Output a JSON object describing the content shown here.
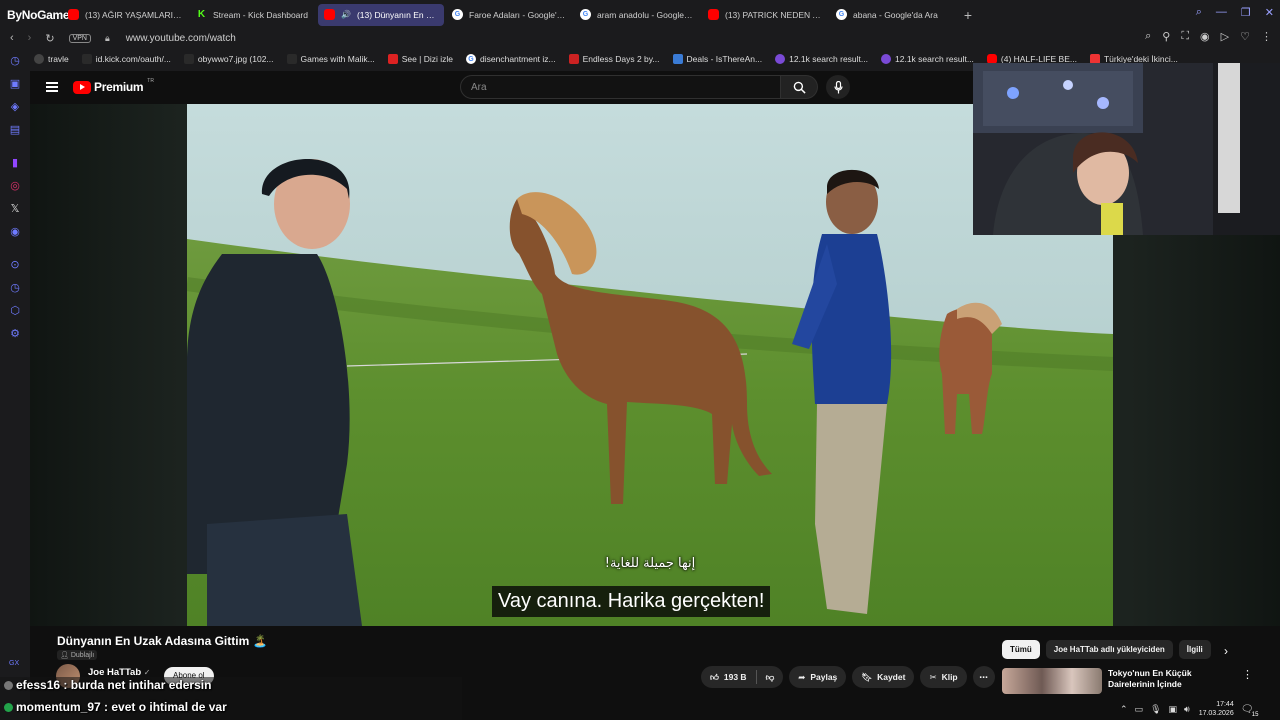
{
  "browser": {
    "brand": "ByNoGame",
    "tabs": [
      {
        "icon": "yt",
        "title": "(13) AĞIR YAŞAMLARIN EN..."
      },
      {
        "icon": "kick",
        "title": "Stream - Kick Dashboard"
      },
      {
        "icon": "yt",
        "title": "(13) Dünyanın En Uzak...",
        "active": true
      },
      {
        "icon": "g",
        "title": "Faroe Adaları - Google'da..."
      },
      {
        "icon": "g",
        "title": "aram anadolu - Google'da..."
      },
      {
        "icon": "yt",
        "title": "(13) PATRICK NEDEN APTA..."
      },
      {
        "icon": "g",
        "title": "abana - Google'da Ara"
      }
    ],
    "url": "www.youtube.com/watch",
    "vpn_label": "VPN",
    "bookmarks": [
      {
        "icon": "globe",
        "label": "travle"
      },
      {
        "icon": "blank",
        "label": "id.kick.com/oauth/..."
      },
      {
        "icon": "blank",
        "label": "obywwo7.jpg (102..."
      },
      {
        "icon": "blank",
        "label": "Games with Malik..."
      },
      {
        "icon": "red",
        "label": "See | Dizi izle"
      },
      {
        "icon": "g",
        "label": "disenchantment iz..."
      },
      {
        "icon": "red",
        "label": "Endless Days 2 by..."
      },
      {
        "icon": "blue",
        "label": "Deals - IsThereAn..."
      },
      {
        "icon": "purple",
        "label": "12.1k search result..."
      },
      {
        "icon": "purple",
        "label": "12.1k search result..."
      },
      {
        "icon": "yt",
        "label": "(4) HALF-LIFE BE..."
      },
      {
        "icon": "red",
        "label": "Türkiye'deki İkinci..."
      }
    ]
  },
  "youtube": {
    "logo_text": "Premium",
    "logo_region": "TR",
    "search_placeholder": "Ara",
    "video": {
      "title": "Dünyanın En Uzak Adasına Gittim 🏝️",
      "dubbed_label": "Dublajlı",
      "subtitle_arabic": "إنها جميلة للغاية!",
      "subtitle_turkish": "Vay canına. Harika gerçekten!"
    },
    "channel": {
      "name": "Joe HaTTab",
      "verified": "✓",
      "subscribe": "Abone ol"
    },
    "actions": {
      "likes": "193 B",
      "share": "Paylaş",
      "save": "Kaydet",
      "clip": "Klip"
    },
    "chips": [
      "Tümü",
      "Joe HaTTab adlı yükleyiciden",
      "İlgili"
    ],
    "recommendation": {
      "title": "Tokyo'nun En Küçük Dairelerinin İçinde"
    }
  },
  "chat": [
    {
      "user": "efess16",
      "message": ": burda net intihar edersin"
    },
    {
      "user": "momentum_97",
      "message": ": evet o ihtimal de var"
    }
  ],
  "taskbar": {
    "time": "17:44",
    "date": "17.03.2026",
    "notifications": "15"
  },
  "colors": {
    "accent": "#6f7bff",
    "yt_red": "#ff0000",
    "active_tab": "#3a3a6e"
  }
}
